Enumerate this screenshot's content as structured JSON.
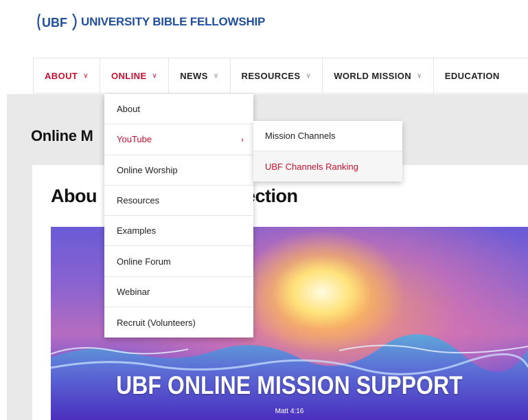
{
  "header": {
    "logo_mark": "UBF",
    "logo_text": "UNIVERSITY BIBLE FELLOWSHIP"
  },
  "nav": {
    "items": [
      {
        "label": "ABOUT",
        "active": true
      },
      {
        "label": "ONLINE",
        "active": true
      },
      {
        "label": "NEWS",
        "active": false
      },
      {
        "label": "RESOURCES",
        "active": false
      },
      {
        "label": "WORLD MISSION",
        "active": false
      },
      {
        "label": "EDUCATION",
        "active": false
      }
    ],
    "chevron": "∨"
  },
  "dropdown": {
    "items": [
      {
        "label": "About"
      },
      {
        "label": "YouTube",
        "has_submenu": true
      },
      {
        "label": "Online Worship"
      },
      {
        "label": "Resources"
      },
      {
        "label": "Examples"
      },
      {
        "label": "Online Forum"
      },
      {
        "label": "Webinar"
      },
      {
        "label": "Recruit (Volunteers)"
      }
    ],
    "submenu_arrow": "›"
  },
  "submenu": {
    "items": [
      {
        "label": "Mission Channels"
      },
      {
        "label": "UBF Channels Ranking"
      }
    ]
  },
  "page": {
    "title": "Online M",
    "card_title": "Abou",
    "card_title_tail": "ection"
  },
  "banner": {
    "title": "UBF ONLINE MISSION SUPPORT",
    "subtitle": "Matt 4:16"
  },
  "colors": {
    "brand_blue": "#1f4e9c",
    "accent_red": "#c8102e",
    "page_grey": "#e9e9e9"
  }
}
